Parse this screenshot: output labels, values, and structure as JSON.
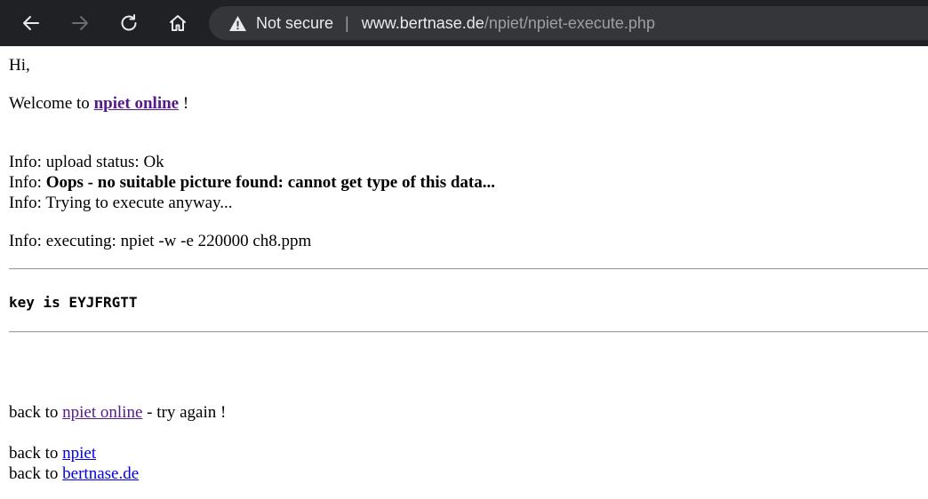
{
  "browser": {
    "security_label": "Not secure",
    "url_host": "www.bertnase.de",
    "url_path": "/npiet/npiet-execute.php"
  },
  "page": {
    "greeting": "Hi,",
    "welcome_prefix": "Welcome to ",
    "welcome_link": "npiet online",
    "welcome_suffix": " !",
    "info_prefix": "Info: ",
    "info_upload": "upload status: Ok",
    "info_error": "Oops - no suitable picture found: cannot get type of this data...",
    "info_trying": "Trying to execute anyway...",
    "info_executing": "executing: npiet -w -e 220000 ch8.ppm",
    "output_key": "key is EYJFRGTT",
    "back_prefix": "back to ",
    "back_online_link": "npiet online",
    "back_online_suffix": " - try again !",
    "back_npiet_link": "npiet",
    "back_site_link": "bertnase.de"
  }
}
